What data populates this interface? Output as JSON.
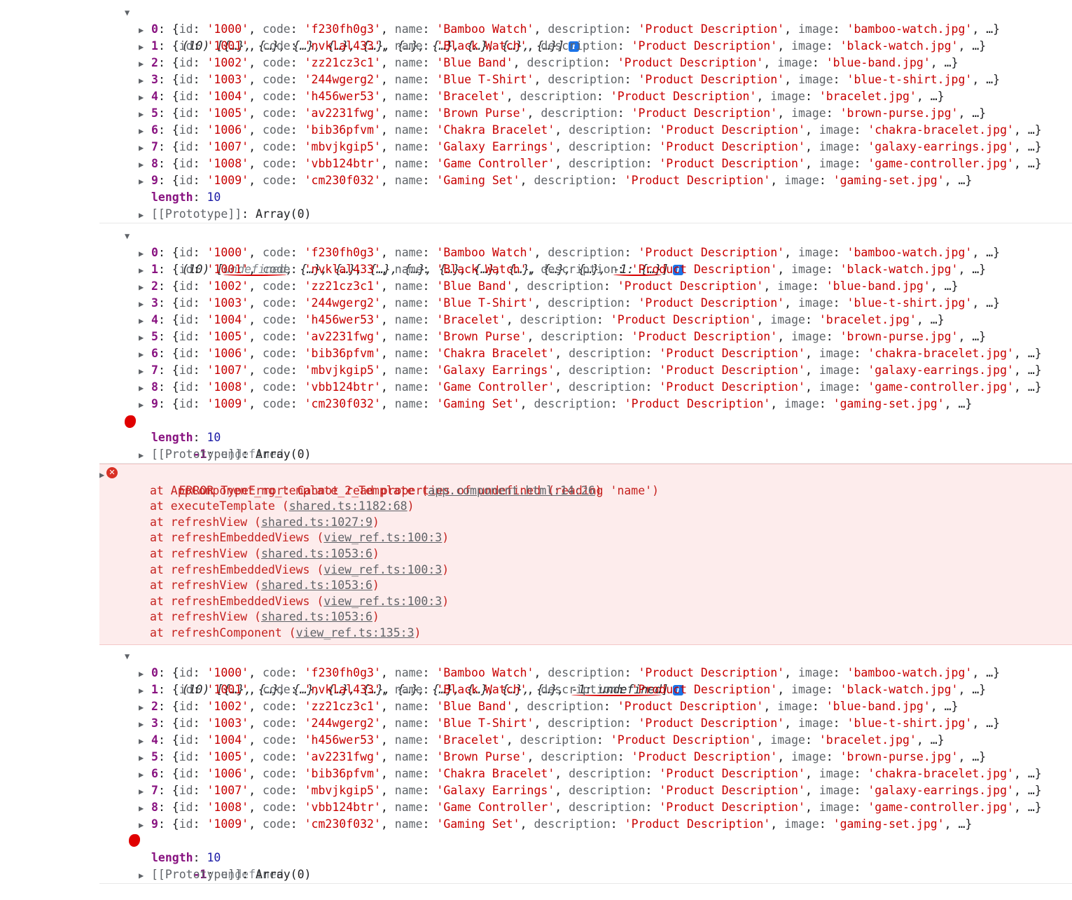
{
  "logs": [
    {
      "summary": "(10) [{…}, {…}, {…}, {…}, {…}, {…}, {…}, {…}, {…}, {…}]",
      "extra_props": [],
      "length_label": "length",
      "length_value": "10",
      "prototype_label": "[[Prototype]]",
      "prototype_value": "Array(0)"
    },
    {
      "summary_parts": [
        "(10) [",
        "undefined",
        ", {…}, {…}, {…}, {…}, {…}, {…}, {…}, {…}, {…}, ",
        "-1: {…}",
        "]"
      ],
      "extra_key": "-1",
      "extra_value": "undefined",
      "length_label": "length",
      "length_value": "10",
      "prototype_label": "[[Prototype]]",
      "prototype_value": "Array(0)"
    },
    {
      "summary_parts": [
        "(10) [{…}, {…}, {…}, {…}, {…}, {…}, {…}, {…}, {…}, {…}, ",
        "-1: undefined",
        "]"
      ],
      "extra_key": "-1",
      "extra_value": "undefined",
      "length_label": "length",
      "length_value": "10",
      "prototype_label": "[[Prototype]]",
      "prototype_value": "Array(0)"
    }
  ],
  "items": [
    {
      "index": "0",
      "id": "'1000'",
      "code": "'f230fh0g3'",
      "name": "'Bamboo Watch'",
      "description": "'Product Description'",
      "image": "'bamboo-watch.jpg'"
    },
    {
      "index": "1",
      "id": "'1001'",
      "code": "'nvklal433'",
      "name": "'Black Watch'",
      "description": "'Product Description'",
      "image": "'black-watch.jpg'"
    },
    {
      "index": "2",
      "id": "'1002'",
      "code": "'zz21cz3c1'",
      "name": "'Blue Band'",
      "description": "'Product Description'",
      "image": "'blue-band.jpg'"
    },
    {
      "index": "3",
      "id": "'1003'",
      "code": "'244wgerg2'",
      "name": "'Blue T-Shirt'",
      "description": "'Product Description'",
      "image": "'blue-t-shirt.jpg'"
    },
    {
      "index": "4",
      "id": "'1004'",
      "code": "'h456wer53'",
      "name": "'Bracelet'",
      "description": "'Product Description'",
      "image": "'bracelet.jpg'"
    },
    {
      "index": "5",
      "id": "'1005'",
      "code": "'av2231fwg'",
      "name": "'Brown Purse'",
      "description": "'Product Description'",
      "image": "'brown-purse.jpg'"
    },
    {
      "index": "6",
      "id": "'1006'",
      "code": "'bib36pfvm'",
      "name": "'Chakra Bracelet'",
      "description": "'Product Description'",
      "image": "'chakra-bracelet.jpg'"
    },
    {
      "index": "7",
      "id": "'1007'",
      "code": "'mbvjkgip5'",
      "name": "'Galaxy Earrings'",
      "description": "'Product Description'",
      "image": "'galaxy-earrings.jpg'"
    },
    {
      "index": "8",
      "id": "'1008'",
      "code": "'vbb124btr'",
      "name": "'Game Controller'",
      "description": "'Product Description'",
      "image": "'game-controller.jpg'"
    },
    {
      "index": "9",
      "id": "'1009'",
      "code": "'cm230f032'",
      "name": "'Gaming Set'",
      "description": "'Product Description'",
      "image": "'gaming-set.jpg'"
    }
  ],
  "error": {
    "message": "ERROR TypeError: Cannot read properties of undefined (reading 'name')",
    "stack": [
      {
        "fn": "at AppComponent_ng_template_2_Template",
        "loc": "app.component.html:14:26"
      },
      {
        "fn": "at executeTemplate",
        "loc": "shared.ts:1182:68"
      },
      {
        "fn": "at refreshView",
        "loc": "shared.ts:1027:9"
      },
      {
        "fn": "at refreshEmbeddedViews",
        "loc": "view_ref.ts:100:3"
      },
      {
        "fn": "at refreshView",
        "loc": "shared.ts:1053:6"
      },
      {
        "fn": "at refreshEmbeddedViews",
        "loc": "view_ref.ts:100:3"
      },
      {
        "fn": "at refreshView",
        "loc": "shared.ts:1053:6"
      },
      {
        "fn": "at refreshEmbeddedViews",
        "loc": "view_ref.ts:100:3"
      },
      {
        "fn": "at refreshView",
        "loc": "shared.ts:1053:6"
      },
      {
        "fn": "at refreshComponent",
        "loc": "view_ref.ts:135:3"
      }
    ]
  },
  "colors": {
    "error_bg": "#fdecec",
    "string": "#c80000",
    "key": "#881280",
    "number": "#1a1aa6",
    "annotation": "#d80000"
  }
}
